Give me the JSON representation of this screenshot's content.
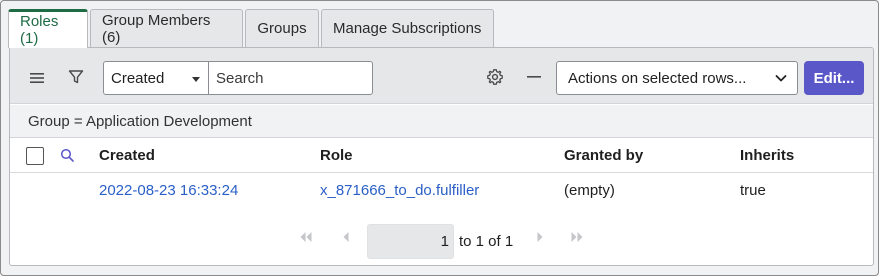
{
  "tabs": [
    {
      "label": "Roles (1)",
      "active": true
    },
    {
      "label": "Group Members (6)",
      "active": false
    },
    {
      "label": "Groups",
      "active": false
    },
    {
      "label": "Manage Subscriptions",
      "active": false
    }
  ],
  "toolbar": {
    "search_field": "Created",
    "search_placeholder": "Search",
    "actions_label": "Actions on selected rows...",
    "edit_label": "Edit..."
  },
  "filter": {
    "breadcrumb": "Group = Application Development"
  },
  "table": {
    "columns": [
      "Created",
      "Role",
      "Granted by",
      "Inherits"
    ],
    "rows": [
      {
        "created": "2022-08-23 16:33:24",
        "role": "x_871666_to_do.fulfiller",
        "granted_by": "(empty)",
        "inherits": "true"
      }
    ]
  },
  "pagination": {
    "current_page": "1",
    "range_text": "to 1 of 1"
  },
  "colors": {
    "active_tab": "#1e6b44",
    "primary_button": "#5a57c9",
    "link": "#2a5fc7"
  }
}
